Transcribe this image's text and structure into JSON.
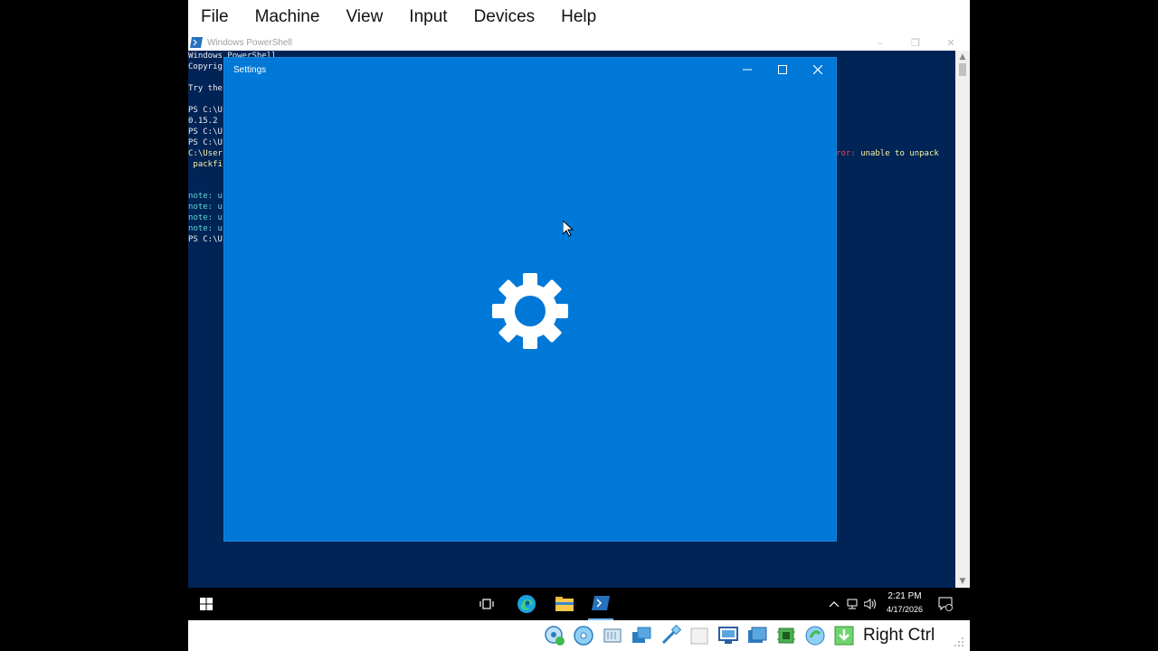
{
  "menu": [
    "File",
    "Machine",
    "View",
    "Input",
    "Devices",
    "Help"
  ],
  "powershell": {
    "title": "Windows PowerShell",
    "lines": [
      {
        "text": "Windows PowerShell",
        "style": "normal"
      },
      {
        "text": "Copyrig",
        "style": "normal"
      },
      {
        "text": "",
        "style": "normal"
      },
      {
        "text": "Try the",
        "style": "normal"
      },
      {
        "text": "",
        "style": "normal"
      },
      {
        "text": "PS C:\\U",
        "style": "normal"
      },
      {
        "text": "0.15.2",
        "style": "normal"
      },
      {
        "text": "PS C:\\U",
        "style": "normal"
      },
      {
        "text": "PS C:\\U",
        "style": "normal"
      },
      {
        "text": "C:\\User",
        "style": "yellow"
      },
      {
        "text": " packfi",
        "style": "yellow"
      },
      {
        "text": "",
        "style": "normal"
      },
      {
        "text": "",
        "style": "normal"
      },
      {
        "text": "note: u",
        "style": "cyan"
      },
      {
        "text": "note: u",
        "style": "cyan"
      },
      {
        "text": "note: u",
        "style": "cyan"
      },
      {
        "text": "note: u",
        "style": "cyan"
      },
      {
        "text": "PS C:\\U",
        "style": "normal"
      }
    ],
    "error_fragment": "ror:",
    "error_message": " unable to unpack"
  },
  "settings": {
    "title": "Settings",
    "icon": "gear-icon"
  },
  "taskbar": {
    "time": "2:21 PM",
    "date": "4/17/2026",
    "pinned": [
      "task-view-icon",
      "edge-icon",
      "file-explorer-icon",
      "powershell-icon"
    ]
  },
  "statusbar": {
    "host_key": "Right Ctrl",
    "icons": [
      "hard-disk-icon",
      "optical-drive-icon",
      "audio-icon",
      "network-icon",
      "usb-icon",
      "shared-folders-icon",
      "display-icon",
      "video-capture-icon",
      "cpu-icon",
      "mouse-integration-icon",
      "download-icon"
    ]
  },
  "colors": {
    "console_bg": "#012456",
    "settings_bg": "#0078d7",
    "taskbar_bg": "#000000"
  }
}
